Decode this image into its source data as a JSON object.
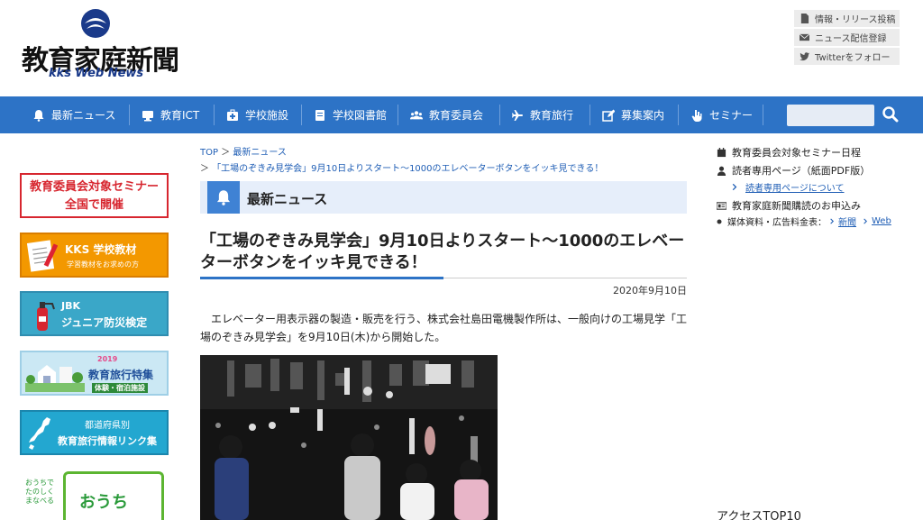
{
  "header": {
    "logo_title": "教育家庭新聞",
    "logo_sub": "kks Web News",
    "top_links": [
      {
        "label": "情報・リリース投稿",
        "icon": "document-icon"
      },
      {
        "label": "ニュース配信登録",
        "icon": "mail-icon"
      },
      {
        "label": "Twitterをフォロー",
        "icon": "twitter-icon"
      }
    ]
  },
  "nav": {
    "items": [
      {
        "label": "最新ニュース",
        "icon": "bell-icon"
      },
      {
        "label": "教育ICT",
        "icon": "monitor-icon"
      },
      {
        "label": "学校施設",
        "icon": "first-aid-icon"
      },
      {
        "label": "学校図書館",
        "icon": "book-icon"
      },
      {
        "label": "教育委員会",
        "icon": "users-icon"
      },
      {
        "label": "教育旅行",
        "icon": "plane-icon"
      },
      {
        "label": "募集案内",
        "icon": "edit-icon"
      },
      {
        "label": "セミナー",
        "icon": "hand-icon"
      }
    ],
    "search_placeholder": ""
  },
  "left_banners": {
    "seminar": {
      "line1": "教育委員会対象セミナー",
      "line2": "全国で開催"
    },
    "kks": {
      "title": "KKS 学校教材",
      "sub": "学習教材をお求めの方"
    },
    "jbk": {
      "line1": "JBK",
      "line2": "ジュニア防災検定"
    },
    "tour": {
      "year": "2019",
      "title": "教育旅行特集",
      "sub": "体験・宿泊施設"
    },
    "pref": {
      "line1": "都道府県別",
      "line2": "教育旅行情報リンク集"
    },
    "ouchi": {
      "side": "おうちで たのしく まなべる",
      "title": "おうち"
    }
  },
  "breadcrumb": {
    "home": "TOP",
    "section": "最新ニュース",
    "current": "「工場のぞきみ見学会」9月10日よりスタート〜1000のエレベーターボタンをイッキ見できる！"
  },
  "section": {
    "title": "最新ニュース"
  },
  "article": {
    "title": "「工場のぞきみ見学会」9月10日よりスタート〜1000のエレベーターボタンをイッキ見できる！",
    "date": "2020年9月10日",
    "body": "エレベーター用表示器の製造・販売を行う、株式会社島田電機製作所は、一般向けの工場見学「工場のぞきみ見学会」を9月10日(木)から開始した。"
  },
  "right": {
    "seminar_schedule": "教育委員会対象セミナー日程",
    "reader_page": "読者専用ページ（紙面PDF版）",
    "reader_about": "読者専用ページについて",
    "subscribe": "教育家庭新聞購読のお申込み",
    "media_label": "媒体資料・広告料金表：",
    "media_news": "新聞",
    "media_web": "Web",
    "access_top": "アクセスTOP10"
  },
  "colors": {
    "nav": "#2d73c6",
    "accent_red": "#d7262f",
    "link": "#1f5eb5"
  }
}
